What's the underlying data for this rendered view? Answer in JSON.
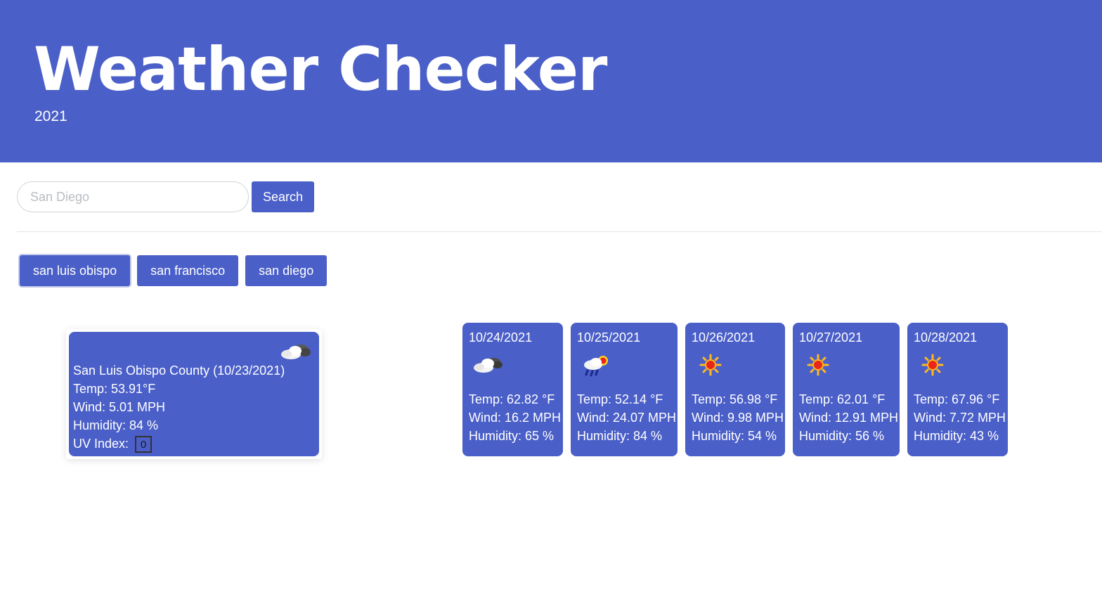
{
  "header": {
    "title": "Weather Checker",
    "subtitle": "2021"
  },
  "search": {
    "placeholder": "San Diego",
    "button_label": "Search"
  },
  "history": [
    "san luis obispo",
    "san francisco",
    "san diego"
  ],
  "current": {
    "title": "San Luis Obispo County (10/23/2021)",
    "temp": "Temp: 53.91°F",
    "wind": "Wind: 5.01 MPH",
    "humidity": "Humidity: 84 %",
    "uv_label": "UV Index:",
    "uv_value": "0",
    "icon": "partly-cloudy-icon"
  },
  "forecast": [
    {
      "date": "10/24/2021",
      "icon": "cloudy-icon",
      "temp": "Temp: 62.82 °F",
      "wind": "Wind: 16.2 MPH",
      "humidity": "Humidity: 65 %"
    },
    {
      "date": "10/25/2021",
      "icon": "rain-sun-icon",
      "temp": "Temp: 52.14 °F",
      "wind": "Wind: 24.07 MPH",
      "humidity": "Humidity: 84 %"
    },
    {
      "date": "10/26/2021",
      "icon": "sun-icon",
      "temp": "Temp: 56.98 °F",
      "wind": "Wind: 9.98 MPH",
      "humidity": "Humidity: 54 %"
    },
    {
      "date": "10/27/2021",
      "icon": "sun-icon",
      "temp": "Temp: 62.01 °F",
      "wind": "Wind: 12.91 MPH",
      "humidity": "Humidity: 56 %"
    },
    {
      "date": "10/28/2021",
      "icon": "sun-icon",
      "temp": "Temp: 67.96 °F",
      "wind": "Wind: 7.72 MPH",
      "humidity": "Humidity: 43 %"
    }
  ],
  "colors": {
    "primary": "#4a5fc8",
    "sun": "#e8261b",
    "cloud": "#f2f2f2"
  }
}
